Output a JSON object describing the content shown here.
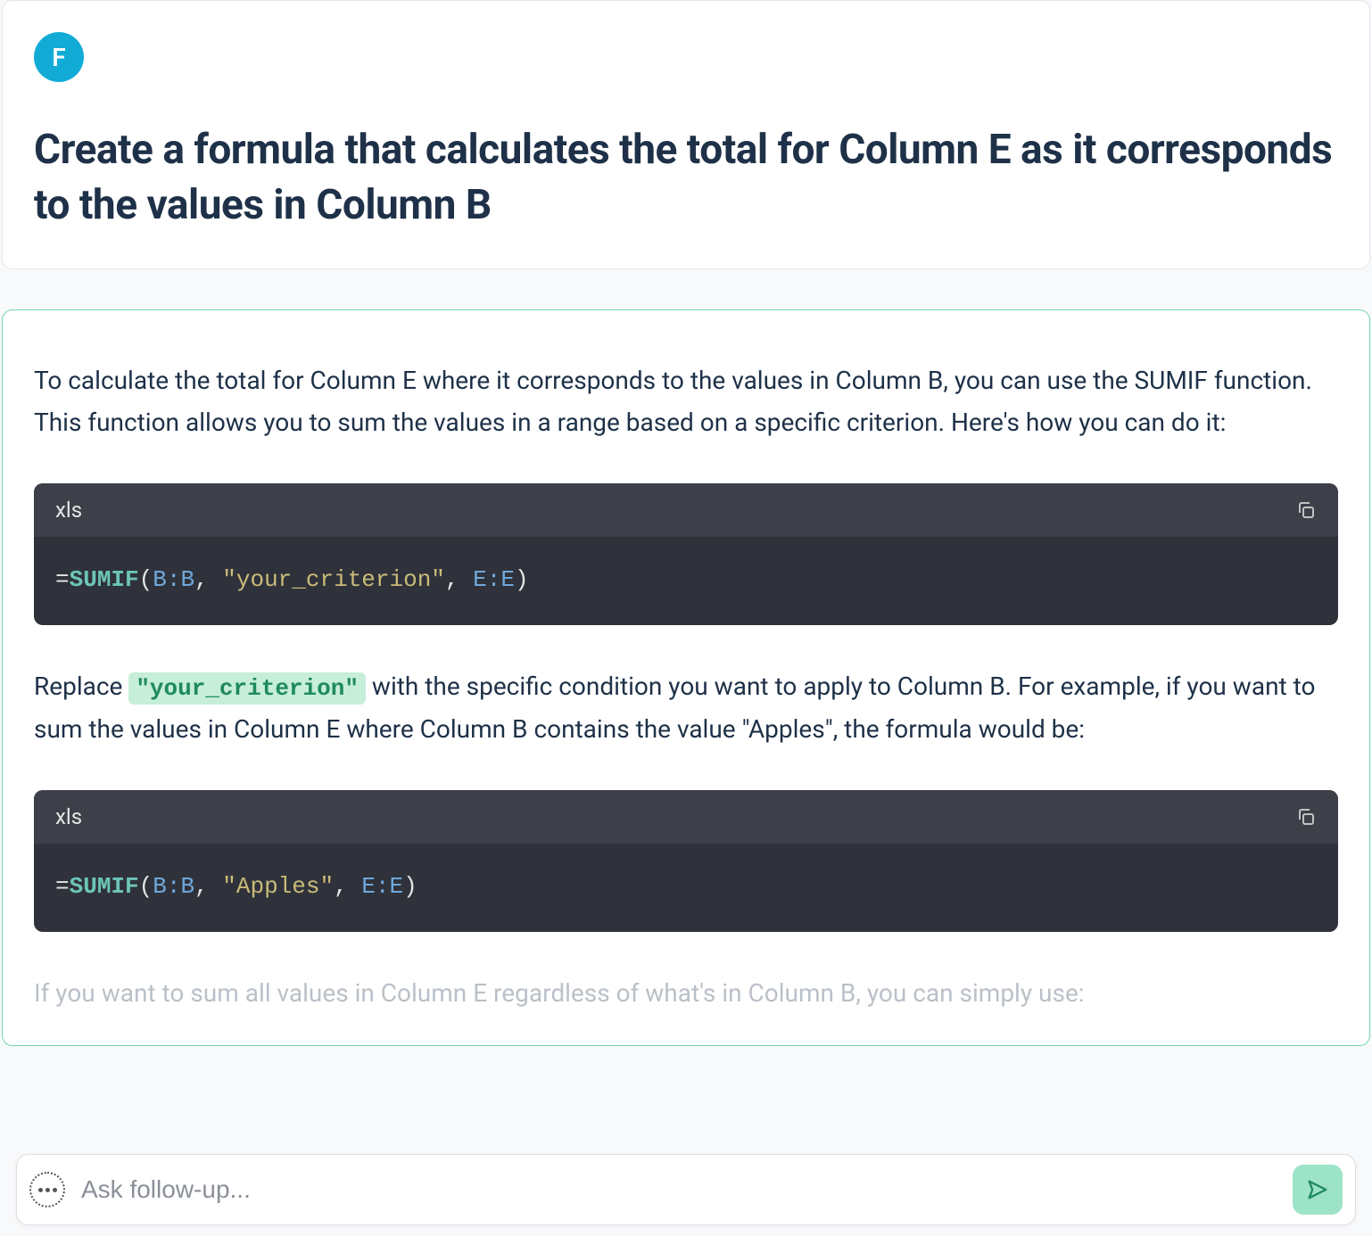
{
  "question": {
    "avatar_letter": "F",
    "title": "Create a formula that calculates the total for Column E as it corresponds to the values in Column B"
  },
  "answer": {
    "intro": "To calculate the total for Column E where it corresponds to the values in Column B, you can use the SUMIF function. This function allows you to sum the values in a range based on a specific criterion. Here's how you can do it:",
    "code1": {
      "lang": "xls",
      "tokens": {
        "eq": "=",
        "fn": "SUMIF",
        "open": "(",
        "ref1": "B:B",
        "comma1": ", ",
        "str": "\"your_criterion\"",
        "comma2": ", ",
        "ref2": "E:E",
        "close": ")"
      }
    },
    "para2_pre": "Replace ",
    "para2_code": "\"your_criterion\"",
    "para2_post": " with the specific condition you want to apply to Column B. For example, if you want to sum the values in Column E where Column B contains the value \"Apples\", the formula would be:",
    "code2": {
      "lang": "xls",
      "tokens": {
        "eq": "=",
        "fn": "SUMIF",
        "open": "(",
        "ref1": "B:B",
        "comma1": ", ",
        "str": "\"Apples\"",
        "comma2": ", ",
        "ref2": "E:E",
        "close": ")"
      }
    },
    "para3": "If you want to sum all values in Column E regardless of what's in Column B, you can simply use:"
  },
  "input": {
    "placeholder": "Ask follow-up..."
  }
}
